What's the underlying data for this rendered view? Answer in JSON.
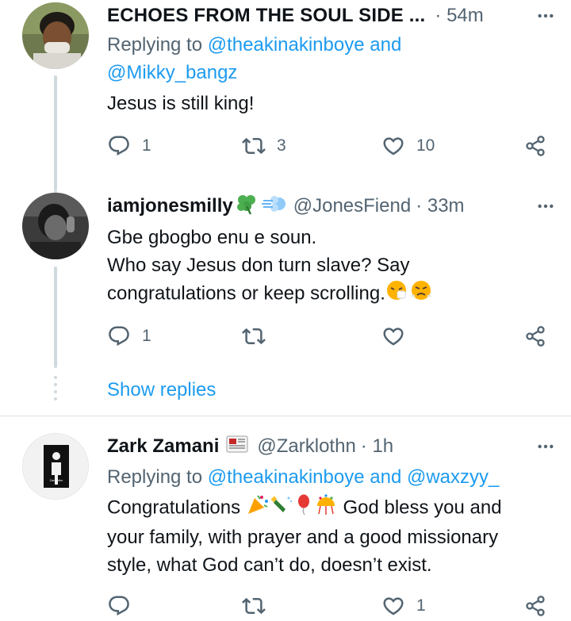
{
  "tweets": [
    {
      "display_name": "ECHOES FROM THE SOUL SIDE ...",
      "handle": "",
      "time": "· 54m",
      "reply_prefix": "Replying to ",
      "reply_user1": "@theakinakinboye",
      "reply_and": " and",
      "reply_user2": "@Mikky_bangz",
      "text": "Jesus is still king!",
      "replies": "1",
      "retweets": "3",
      "likes": "10"
    },
    {
      "display_name": "iamjonesmilly",
      "handle": "@JonesFiend",
      "time": "· 33m",
      "line1": "Gbe gbogbo enu e soun.",
      "line2": "Who say Jesus don turn slave? Say",
      "line3": "congratulations or keep scrolling.",
      "replies": "1",
      "retweets": "",
      "likes": ""
    },
    {
      "display_name": "Zark Zamani",
      "handle": "@Zarklothn",
      "time": "· 1h",
      "reply_prefix": "Replying to ",
      "reply_user1": "@theakinakinboye",
      "reply_and": " and ",
      "reply_user2": "@waxzyy_",
      "line1_start": "Congratulations",
      "line1_end": "God bless you and",
      "line2": "your family, with prayer and a good missionary",
      "line3": "style, what God can’t do, doesn’t exist.",
      "replies": "",
      "retweets": "",
      "likes": "1"
    }
  ],
  "show_replies": "Show replies",
  "avatar3_caption": "Zarklothn",
  "icons": {
    "more": "more-icon",
    "reply": "reply-icon",
    "retweet": "retweet-icon",
    "like": "heart-icon",
    "share": "share-icon"
  },
  "colors": {
    "link": "#1d9bf0",
    "muted": "#536471",
    "thread_line": "#cfd9de"
  }
}
